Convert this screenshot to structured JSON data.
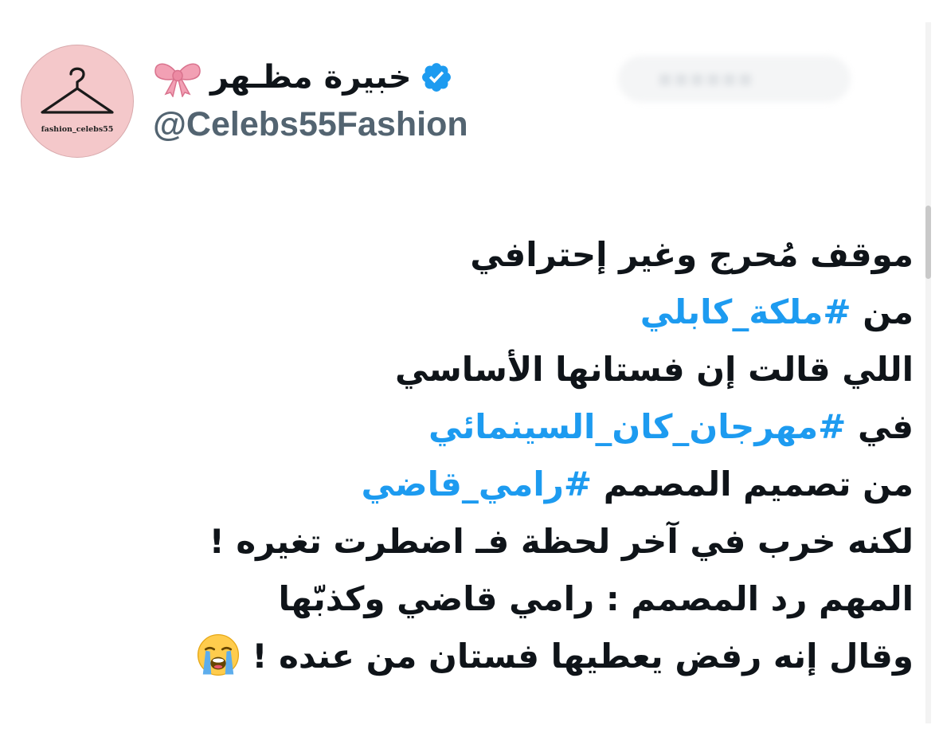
{
  "profile": {
    "display_name": "خبيرة مظـهر",
    "handle": "@Celebs55Fashion",
    "avatar_label": "fashion_celebs55",
    "verified_icon": "verified-badge-icon",
    "name_emoji": "ribbon-bow-icon"
  },
  "tweet": {
    "line_1": {
      "text": "موقف مُحرج وغير إحترافي"
    },
    "line_2": {
      "prefix": "من ",
      "hashtag": "#ملكة_كابلي"
    },
    "line_3": {
      "text": "اللي قالت إن فستانها الأساسي"
    },
    "line_4": {
      "prefix": "في ",
      "hashtag": "#مهرجان_كان_السينمائي"
    },
    "line_5": {
      "prefix": "من تصميم المصمم ",
      "hashtag": "#رامي_قاضي"
    },
    "line_6": {
      "text": "لكنه خرب في آخر لحظة فـ اضطرت تغيره !"
    },
    "line_7": {
      "text": "المهم رد المصمم : رامي قاضي وكذبّها"
    },
    "line_8": {
      "text": "وقال إنه رفض يعطيها فستان من عنده !",
      "emoji": "loudly-crying-face-icon"
    }
  },
  "colors": {
    "text": "#0f1419",
    "hashtag": "#1d9bf0",
    "handle": "#536471",
    "verified": "#1d9bf0",
    "avatar_bg": "#f4c8ca",
    "bow": "#f2a0b4"
  }
}
